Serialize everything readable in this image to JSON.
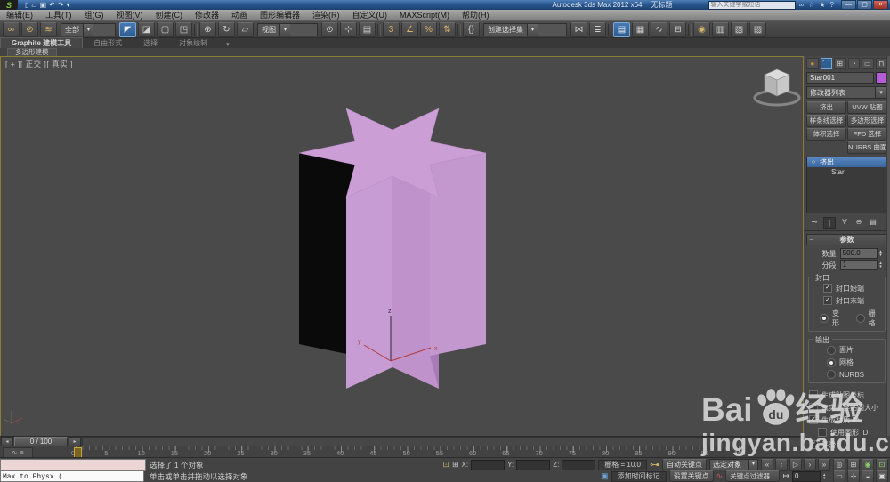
{
  "colors": {
    "titlebar_blue": "#2a5790",
    "accent_blue": "#2e5d8e",
    "viewport_border": "#8f7c33",
    "object_purple": "#c99bd4",
    "swatch_purple": "#b75cd8",
    "macro_pink": "#ecd5d5",
    "gold_icon": "#d7b469",
    "green_icon": "#8fce6a"
  },
  "icons": {
    "chevron_down": "▾",
    "spin_up": "▴",
    "spin_down": "▾",
    "minus": "−",
    "logo_glyph": "S"
  },
  "title_bar": {
    "app_title": "Autodesk 3ds Max  2012 x64",
    "doc_title": "无标题",
    "search_placeholder": "输入关键字或短语",
    "quick_access": [
      {
        "name": "new-file-icon",
        "glyph": "▯"
      },
      {
        "name": "open-file-icon",
        "glyph": "▱"
      },
      {
        "name": "save-file-icon",
        "glyph": "▣"
      },
      {
        "name": "undo-icon",
        "glyph": "↶"
      },
      {
        "name": "redo-icon",
        "glyph": "↷"
      },
      {
        "name": "quick-access-dropdown-icon",
        "glyph": "▾"
      }
    ],
    "search_icons": [
      {
        "name": "search-icon",
        "glyph": "∞"
      },
      {
        "name": "communication-center-icon",
        "glyph": "☆"
      },
      {
        "name": "favorites-icon",
        "glyph": "★"
      },
      {
        "name": "help-icon",
        "glyph": "?"
      }
    ],
    "window_buttons": [
      {
        "name": "minimize-button",
        "glyph": "—",
        "cls": ""
      },
      {
        "name": "maximize-button",
        "glyph": "▢",
        "cls": ""
      },
      {
        "name": "close-button",
        "glyph": "×",
        "cls": "close"
      }
    ]
  },
  "menu_bar": {
    "items": [
      {
        "label": "编辑(E)"
      },
      {
        "label": "工具(T)"
      },
      {
        "label": "组(G)"
      },
      {
        "label": "视图(V)"
      },
      {
        "label": "创建(C)"
      },
      {
        "label": "修改器"
      },
      {
        "label": "动画"
      },
      {
        "label": "图形编辑器"
      },
      {
        "label": "渲染(R)"
      },
      {
        "label": "自定义(U)"
      },
      {
        "label": "MAXScript(M)"
      },
      {
        "label": "帮助(H)"
      }
    ]
  },
  "toolbar": {
    "filter_dropdown": "全部",
    "coord_dropdown": "视图",
    "sets_dropdown": "创建选择集",
    "link_icons": [
      {
        "name": "select-and-link-icon",
        "glyph": "∞",
        "cls": "gold"
      },
      {
        "name": "unlink-selection-icon",
        "glyph": "⊘",
        "cls": "gold"
      },
      {
        "name": "bind-to-space-warp-icon",
        "glyph": "≋",
        "cls": "gold"
      }
    ],
    "select_icons": [
      {
        "name": "select-object-icon",
        "glyph": "◤",
        "cls": "active"
      },
      {
        "name": "select-by-name-icon",
        "glyph": "◪",
        "cls": ""
      },
      {
        "name": "rect-selection-region-icon",
        "glyph": "▢",
        "cls": ""
      },
      {
        "name": "window-crossing-icon",
        "glyph": "◳",
        "cls": ""
      },
      {
        "name": "separator",
        "glyph": "",
        "cls": "sep"
      },
      {
        "name": "select-and-move-icon",
        "glyph": "⊕",
        "cls": ""
      },
      {
        "name": "select-and-rotate-icon",
        "glyph": "↻",
        "cls": ""
      },
      {
        "name": "select-and-scale-icon",
        "glyph": "▱",
        "cls": ""
      }
    ],
    "snap_icons": [
      {
        "name": "use-pivot-point-center-icon",
        "glyph": "⊙",
        "cls": ""
      },
      {
        "name": "select-and-manipulate-icon",
        "glyph": "⊹",
        "cls": ""
      },
      {
        "name": "keyboard-override-icon",
        "glyph": "▤",
        "cls": ""
      },
      {
        "name": "separator",
        "glyph": "",
        "cls": "sep"
      },
      {
        "name": "snaps-toggle-3d-icon",
        "glyph": "3",
        "cls": "gold"
      },
      {
        "name": "angle-snap-icon",
        "glyph": "∠",
        "cls": "gold"
      },
      {
        "name": "percent-snap-icon",
        "glyph": "%",
        "cls": "gold"
      },
      {
        "name": "spinner-snap-icon",
        "glyph": "⇅",
        "cls": "gold"
      },
      {
        "name": "separator",
        "glyph": "",
        "cls": "sep"
      },
      {
        "name": "edit-named-selection-sets-icon",
        "glyph": "{}",
        "cls": ""
      }
    ],
    "tool_icons": [
      {
        "name": "mirror-icon",
        "glyph": "⋈",
        "cls": ""
      },
      {
        "name": "align-icon",
        "glyph": "≣",
        "cls": ""
      },
      {
        "name": "separator",
        "glyph": "",
        "cls": "sep"
      },
      {
        "name": "layer-manager-icon",
        "glyph": "▤",
        "cls": "active"
      },
      {
        "name": "ribbon-toggle-icon",
        "glyph": "▦",
        "cls": ""
      },
      {
        "name": "curve-editor-icon",
        "glyph": "∿",
        "cls": ""
      },
      {
        "name": "schematic-view-icon",
        "glyph": "⊟",
        "cls": ""
      },
      {
        "name": "separator",
        "glyph": "",
        "cls": "sep"
      },
      {
        "name": "material-editor-icon",
        "glyph": "◉",
        "cls": "gold"
      },
      {
        "name": "render-setup-icon",
        "glyph": "▥",
        "cls": ""
      },
      {
        "name": "rendered-frame-window-icon",
        "glyph": "▧",
        "cls": ""
      },
      {
        "name": "render-production-icon",
        "glyph": "▨",
        "cls": ""
      }
    ]
  },
  "ribbon": {
    "tabs": [
      {
        "label": "Graphite 建模工具",
        "cls": "active"
      },
      {
        "label": "自由形式",
        "cls": ""
      },
      {
        "label": "选择",
        "cls": ""
      },
      {
        "label": "对象绘制",
        "cls": ""
      }
    ],
    "controls": [
      {
        "name": "ribbon-minimize-icon",
        "glyph": "▾"
      }
    ],
    "panel_chip": "多边形建模"
  },
  "viewport": {
    "label": "[ + ][ 正交 ][ 真实 ]",
    "axis_labels": {
      "x": "x",
      "y": "y",
      "z": "z"
    }
  },
  "command_panel": {
    "tabs": [
      {
        "name": "create-tab-icon",
        "glyph": "●",
        "cls": "",
        "inner": "orange"
      },
      {
        "name": "modify-tab-icon",
        "glyph": "⌒",
        "cls": "blue",
        "inner": ""
      },
      {
        "name": "hierarchy-tab-icon",
        "glyph": "⊞",
        "cls": "",
        "inner": ""
      },
      {
        "name": "motion-tab-icon",
        "glyph": "◔",
        "cls": "",
        "inner": ""
      },
      {
        "name": "display-tab-icon",
        "glyph": "▭",
        "cls": "",
        "inner": ""
      },
      {
        "name": "utilities-tab-icon",
        "glyph": "⊓",
        "cls": "",
        "inner": ""
      }
    ],
    "object_name": "Star001",
    "modifier_list_label": "修改器列表",
    "modifier_buttons": [
      {
        "label": "挤出",
        "cls": ""
      },
      {
        "label": "UVW 贴图",
        "cls": ""
      },
      {
        "label": "样条线选择",
        "cls": ""
      },
      {
        "label": "多边形选择",
        "cls": ""
      },
      {
        "label": "体积选择",
        "cls": ""
      },
      {
        "label": "FFD 选择",
        "cls": ""
      },
      {
        "label": "",
        "cls": "empty"
      },
      {
        "label": "NURBS 曲面选择",
        "cls": ""
      }
    ],
    "stack_items": [
      {
        "name": "stack-item-extrude",
        "label": "挤出",
        "cls": "selected",
        "bulb": "○"
      },
      {
        "name": "stack-item-star",
        "label": "Star",
        "cls": "child",
        "bulb": ""
      }
    ],
    "stack_tools": [
      {
        "name": "pin-stack-icon",
        "glyph": "⊸",
        "cls": ""
      },
      {
        "name": "show-end-result-icon",
        "glyph": "∣",
        "cls": "pressed"
      },
      {
        "name": "make-unique-icon",
        "glyph": "∀",
        "cls": ""
      },
      {
        "name": "remove-modifier-icon",
        "glyph": "⊖",
        "cls": ""
      },
      {
        "name": "configure-modifier-sets-icon",
        "glyph": "▤",
        "cls": ""
      }
    ],
    "rollout_title": "参数",
    "params": {
      "amount_label": "数量:",
      "amount_value": "500.0",
      "segments_label": "分段:",
      "segments_value": "1"
    },
    "capping": {
      "title": "封口",
      "checks": [
        {
          "label": "封口始端",
          "state": "checked",
          "cls": ""
        },
        {
          "label": "封口末端",
          "state": "checked",
          "cls": ""
        }
      ],
      "radios": [
        {
          "label": "变形",
          "state": "selected"
        },
        {
          "label": "栅格",
          "state": "unselected"
        }
      ]
    },
    "output": {
      "title": "输出",
      "radios": [
        {
          "label": "面片",
          "state": "unselected"
        },
        {
          "label": "网格",
          "state": "selected"
        },
        {
          "label": "NURBS",
          "state": "unselected"
        }
      ]
    },
    "options": [
      {
        "label": "生成贴图坐标",
        "state": "unchecked",
        "cls": "plain"
      },
      {
        "label": "真实世界贴图大小",
        "state": "unchecked",
        "cls": "plain"
      },
      {
        "label": "生成材质 ID",
        "state": "checked",
        "cls": "plain"
      },
      {
        "label": "使用图形 ID",
        "state": "unchecked",
        "cls": "indent"
      },
      {
        "label": "平滑",
        "state": "checked",
        "cls": "plain"
      }
    ]
  },
  "timeline": {
    "slider_value": "0 / 100",
    "prev": "◂",
    "next": "▸",
    "ruler_icons": [
      {
        "name": "mini-curve-editor-icon",
        "glyph": "∿"
      },
      {
        "name": "mini-track-view-icon",
        "glyph": "≡"
      }
    ],
    "ticks": [
      "0",
      "5",
      "10",
      "15",
      "20",
      "25",
      "30",
      "35",
      "40",
      "45",
      "50",
      "55",
      "60",
      "65",
      "70",
      "75",
      "80",
      "85",
      "90",
      "95",
      "100"
    ]
  },
  "status_bar": {
    "listener_text": "Max to Physx (",
    "status_line": "选择了 1 个对象",
    "prompt_line": "单击或单击并拖动以选择对象",
    "lock_icon": "⊡",
    "abs_offset_icon": "⊞",
    "key_icon": "⊶",
    "curve_icon": "∿",
    "add_tag_icon": "▣",
    "x_label": "X:",
    "y_label": "Y:",
    "z_label": "Z:",
    "x_value": "",
    "y_value": "",
    "z_value": "",
    "grid_label": "栅格 = 10.0",
    "add_time_tag": "添加时间标记",
    "auto_key": "自动关键点",
    "set_key": "设置关键点",
    "selection_dropdown": "选定对象",
    "key_filters": "关键点过滤器...",
    "key_mode_glyph": "↦",
    "frame_value": "0",
    "playback": [
      {
        "name": "go-to-start-button",
        "glyph": "«",
        "cls": ""
      },
      {
        "name": "previous-frame-button",
        "glyph": "‹",
        "cls": ""
      },
      {
        "name": "play-button",
        "glyph": "▷",
        "cls": ""
      },
      {
        "name": "next-frame-button",
        "glyph": "›",
        "cls": ""
      },
      {
        "name": "go-to-end-button",
        "glyph": "»",
        "cls": ""
      }
    ],
    "nav_row1": [
      {
        "name": "zoom-button",
        "glyph": "◎",
        "cls": ""
      },
      {
        "name": "zoom-all-button",
        "glyph": "⊞",
        "cls": ""
      },
      {
        "name": "zoom-extents-button",
        "glyph": "◉",
        "cls": "green"
      },
      {
        "name": "zoom-extents-all-button",
        "glyph": "⊡",
        "cls": "green"
      }
    ],
    "nav_row2": [
      {
        "name": "zoom-region-button",
        "glyph": "▭",
        "cls": ""
      },
      {
        "name": "pan-button",
        "glyph": "⊹",
        "cls": ""
      },
      {
        "name": "orbit-button",
        "glyph": "◒",
        "cls": ""
      },
      {
        "name": "maximize-viewport-button",
        "glyph": "▣",
        "cls": ""
      }
    ]
  },
  "watermark": {
    "brand_prefix": "Bai",
    "paw_text": "du",
    "brand_suffix": "经验",
    "url": "jingyan.baidu.com"
  }
}
